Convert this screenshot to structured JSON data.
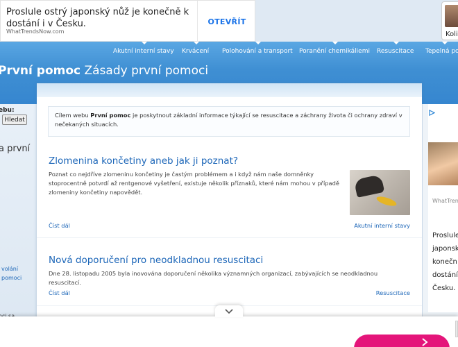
{
  "top_ad": {
    "text": "Proslule ostrý japonský nůž je konečně k dostání i v Česku.",
    "source": "WhatTrendsNow.com",
    "cta": "OTEVŘÍT",
    "side_card_label": "Koli"
  },
  "nav": {
    "items": [
      "Akutní interní stavy",
      "Krvácení",
      "Polohování a transport",
      "Poranění chemikáliemi",
      "Resuscitace",
      "Tepelná poš"
    ]
  },
  "site": {
    "title_bold": "První pomoc",
    "title_rest": " Zásady první pomoci"
  },
  "left": {
    "search_label": "ebu:",
    "search_button": "Hledat",
    "heading": "a první",
    "link_1": "volání",
    "link_2": "pomoci",
    "bottom_text": "oci sa"
  },
  "intro": {
    "part_1": "Cílem webu ",
    "bold": "První pomoc",
    "part_2": " je poskytnout základní informace týkající se resuscitace a záchrany života či ochrany zdraví v nečekaných situacích."
  },
  "articles": [
    {
      "title": "Zlomenina končetiny aneb jak ji poznat?",
      "excerpt": "Poznat co nejdříve zlomeninu končetiny je častým problémem a i když nám naše domněnky stoprocentně potvrdí až rentgenové vyšetření, existuje několik příznaků, které nám mohou v případě zlomeniny končetiny napovědět.",
      "read_more": "Číst dál",
      "category": "Akutní interní stavy"
    },
    {
      "title": "Nová doporučení pro neodkladnou resuscitaci",
      "excerpt": "Dne 28. listopadu 2005 byla inovována doporučení několika významných organizací, zabývajících se neodkladnou resuscitací.",
      "read_more": "Číst dál",
      "category": "Resuscitace"
    }
  ],
  "right_ad": {
    "source": "WhatTren",
    "text": "Proslule japonsk konečn dostání Česku."
  },
  "colors": {
    "header": "#3f8fd3",
    "link": "#1c66b8",
    "cta_pink": "#e4157a",
    "ad_cta_blue": "#1a73e8"
  }
}
